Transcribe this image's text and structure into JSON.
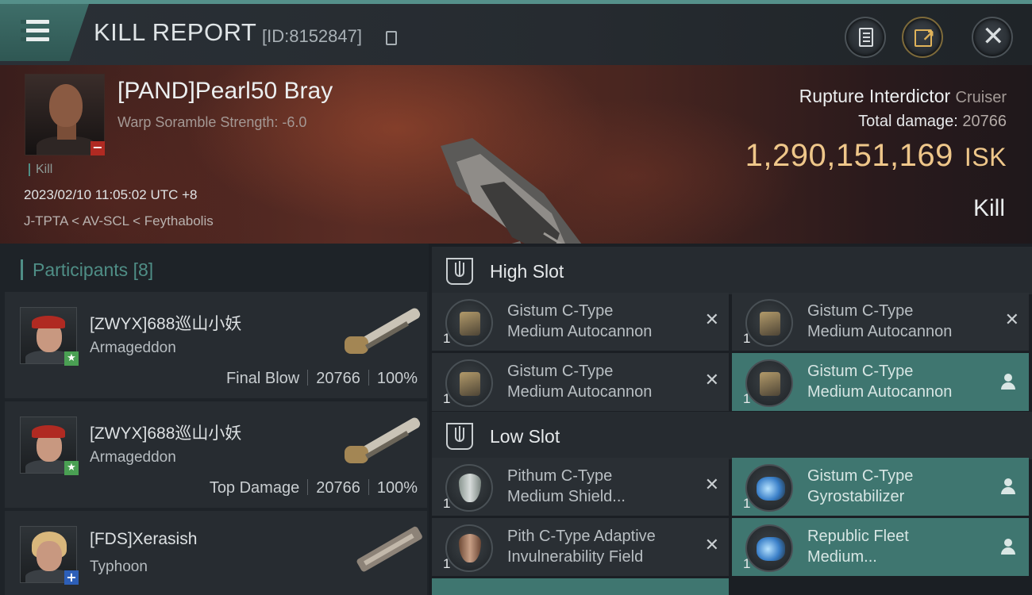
{
  "header": {
    "title": "KILL REPORT",
    "kill_id": "[ID:8152847]"
  },
  "victim": {
    "name": "[PAND]Pearl50 Bray",
    "attribute": "Warp Soramble Strength: -6.0",
    "tag": "Kill",
    "datetime": "2023/02/10 11:05:02 UTC +8",
    "location": "J-TPTA < AV-SCL < Feythabolis",
    "ship": "Rupture Interdictor",
    "ship_class": "Cruiser",
    "total_damage_label": "Total damage:",
    "total_damage": "20766",
    "isk_value": "1,290,151,169",
    "isk_unit": "ISK",
    "result": "Kill"
  },
  "participants": {
    "title": "Participants",
    "count": "[8]",
    "rows": [
      {
        "name": "[ZWYX]688巡山小妖",
        "ship": "Armageddon",
        "role": "Final Blow",
        "damage": "20766",
        "percent": "100%"
      },
      {
        "name": "[ZWYX]688巡山小妖",
        "ship": "Armageddon",
        "role": "Top Damage",
        "damage": "20766",
        "percent": "100%"
      },
      {
        "name": "[FDS]Xerasish",
        "ship": "Typhoon"
      }
    ]
  },
  "fitting": {
    "high_slot_label": "High Slot",
    "low_slot_label": "Low Slot",
    "high": [
      {
        "line1": "Gistum C-Type",
        "line2": "Medium Autocannon",
        "qty": "1",
        "state": "destroyed"
      },
      {
        "line1": "Gistum C-Type",
        "line2": "Medium Autocannon",
        "qty": "1",
        "state": "destroyed"
      },
      {
        "line1": "Gistum C-Type",
        "line2": "Medium Autocannon",
        "qty": "1",
        "state": "destroyed"
      },
      {
        "line1": "Gistum C-Type",
        "line2": "Medium Autocannon",
        "qty": "1",
        "state": "dropped"
      }
    ],
    "low": [
      {
        "line1": "Pithum C-Type",
        "line2": "Medium Shield...",
        "qty": "1",
        "state": "destroyed"
      },
      {
        "line1": "Gistum C-Type",
        "line2": "Gyrostabilizer",
        "qty": "1",
        "state": "dropped"
      },
      {
        "line1": "Pith C-Type Adaptive",
        "line2": "Invulnerability Field",
        "qty": "1",
        "state": "destroyed"
      },
      {
        "line1": "Republic Fleet",
        "line2": "Medium...",
        "qty": "1",
        "state": "dropped"
      }
    ]
  },
  "icons": {
    "menu": "hamburger-icon",
    "copy": "copy-icon",
    "clipboard": "clipboard-icon",
    "share": "share-icon",
    "close": "close-icon",
    "destroyed": "x-icon",
    "dropped": "person-icon"
  },
  "colors": {
    "accent": "#4f8e86",
    "isk": "#efc78a",
    "dropped_row": "#3f7670",
    "destroyed_row": "#2a2f34"
  }
}
